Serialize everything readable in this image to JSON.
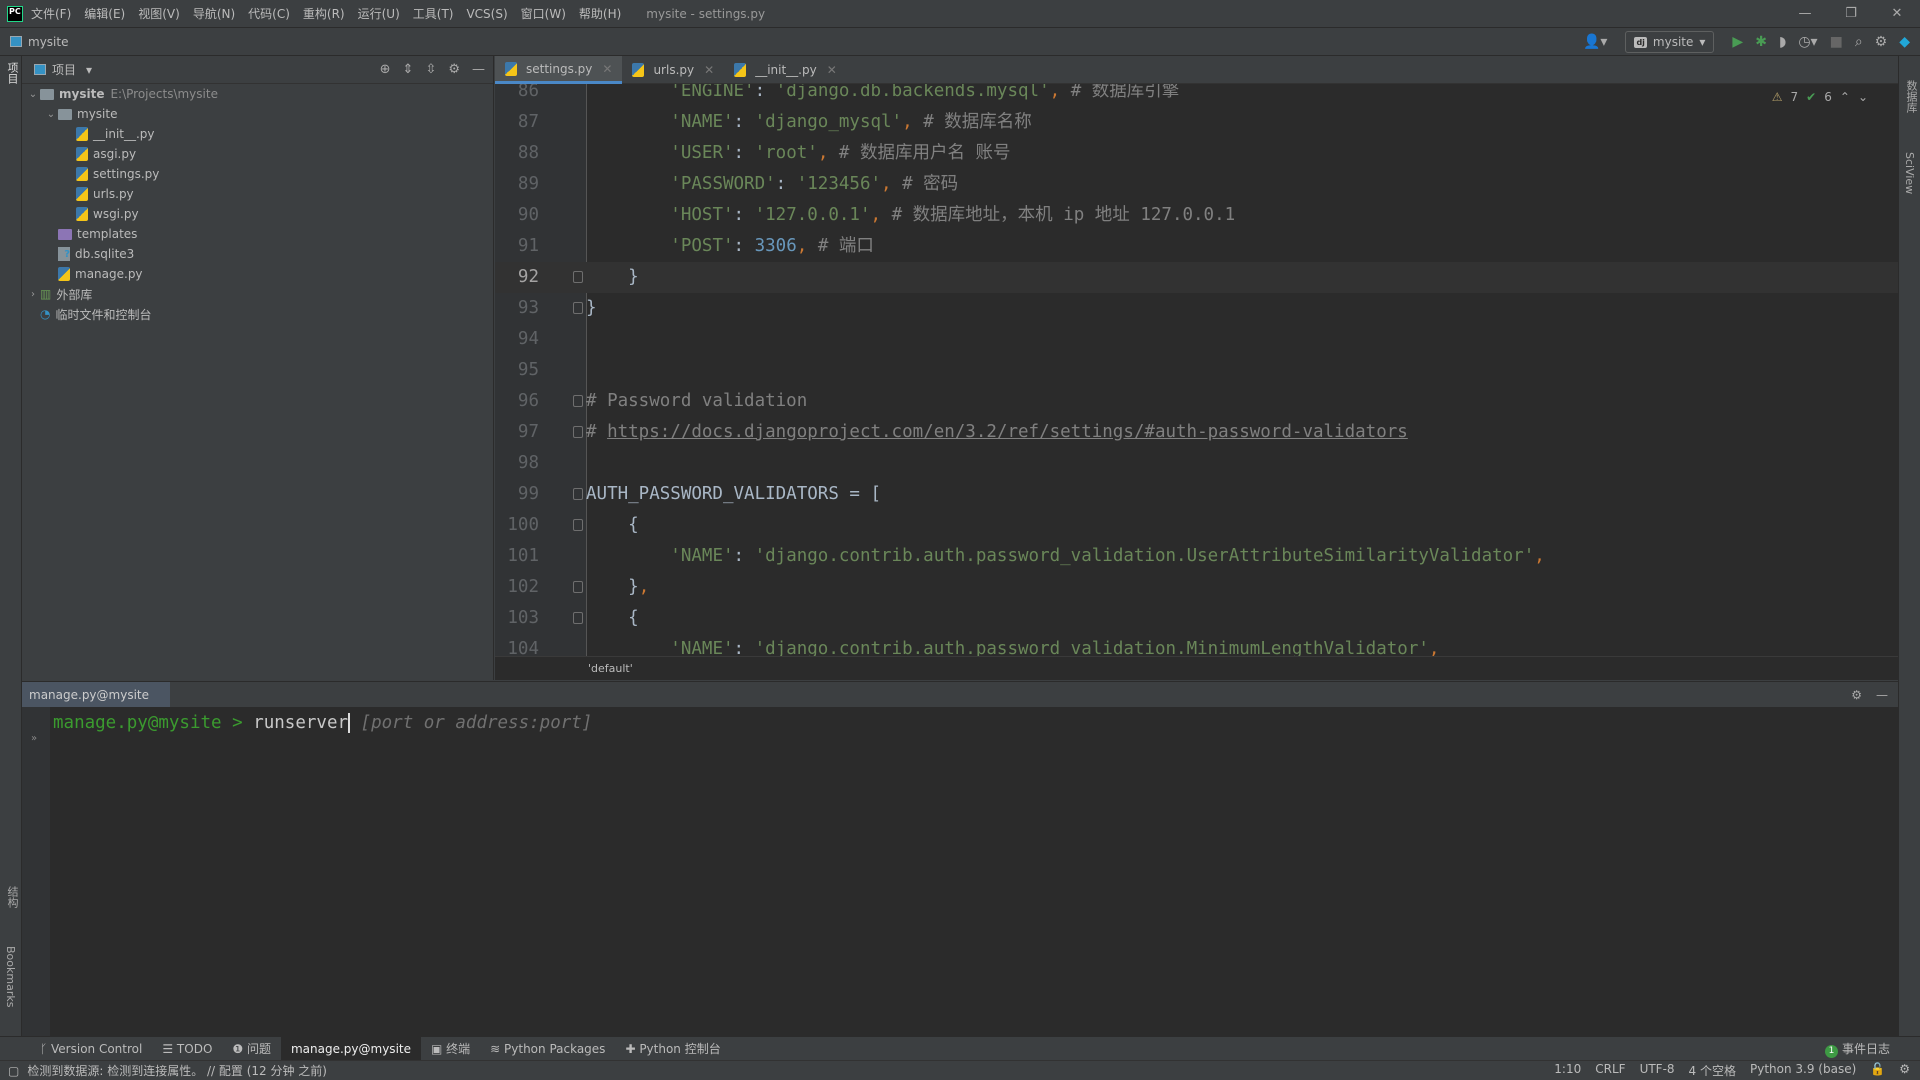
{
  "app": {
    "logo": "PC",
    "window_title": "mysite - settings.py",
    "menu": [
      "文件(F)",
      "编辑(E)",
      "视图(V)",
      "导航(N)",
      "代码(C)",
      "重构(R)",
      "运行(U)",
      "工具(T)",
      "VCS(S)",
      "窗口(W)",
      "帮助(H)"
    ],
    "window_controls": [
      "minimize",
      "restore",
      "close"
    ]
  },
  "nav": {
    "project": "mysite",
    "run_config": "mysite",
    "run_config_badge": "dj"
  },
  "left_strip": {
    "top_label": "项目",
    "bottom_labels": [
      "结构",
      "Bookmarks"
    ]
  },
  "right_strip": {
    "labels": [
      "数据库",
      "SciView"
    ]
  },
  "project_panel": {
    "title": "项目",
    "tree": [
      {
        "label": "mysite",
        "path": "E:\\Projects\\mysite",
        "type": "root",
        "level": 0,
        "expanded": true
      },
      {
        "label": "mysite",
        "type": "package",
        "level": 1,
        "expanded": true
      },
      {
        "label": "__init__.py",
        "type": "py",
        "level": 2
      },
      {
        "label": "asgi.py",
        "type": "py",
        "level": 2
      },
      {
        "label": "settings.py",
        "type": "py",
        "level": 2
      },
      {
        "label": "urls.py",
        "type": "py",
        "level": 2
      },
      {
        "label": "wsgi.py",
        "type": "py",
        "level": 2
      },
      {
        "label": "templates",
        "type": "templates",
        "level": 1
      },
      {
        "label": "db.sqlite3",
        "type": "unknown",
        "level": 1
      },
      {
        "label": "manage.py",
        "type": "py",
        "level": 1
      },
      {
        "label": "外部库",
        "type": "lib",
        "level": 0,
        "expanded": false
      },
      {
        "label": "临时文件和控制台",
        "type": "scratch",
        "level": 0
      }
    ]
  },
  "editor": {
    "tabs": [
      {
        "label": "settings.py",
        "active": true
      },
      {
        "label": "urls.py"
      },
      {
        "label": "__init__.py"
      }
    ],
    "inspections": {
      "warnings": "7",
      "weak_warnings": "6"
    },
    "current_line": 92,
    "lines": [
      {
        "n": "86",
        "t": [
          [
            "        ",
            ""
          ],
          [
            "'ENGINE'",
            "str"
          ],
          [
            ": ",
            ""
          ],
          [
            "'django.db.backends.mysql'",
            "str"
          ],
          [
            ",",
            "pun"
          ],
          [
            " # 数据库引擎",
            "com"
          ]
        ]
      },
      {
        "n": "87",
        "t": [
          [
            "        ",
            ""
          ],
          [
            "'NAME'",
            "str"
          ],
          [
            ": ",
            ""
          ],
          [
            "'django_mysql'",
            "str"
          ],
          [
            ",",
            "pun"
          ],
          [
            " # 数据库名称",
            "com"
          ]
        ]
      },
      {
        "n": "88",
        "t": [
          [
            "        ",
            ""
          ],
          [
            "'USER'",
            "str"
          ],
          [
            ": ",
            ""
          ],
          [
            "'root'",
            "str"
          ],
          [
            ",",
            "pun"
          ],
          [
            " # 数据库用户名 账号",
            "com"
          ]
        ]
      },
      {
        "n": "89",
        "t": [
          [
            "        ",
            ""
          ],
          [
            "'PASSWORD'",
            "str"
          ],
          [
            ": ",
            ""
          ],
          [
            "'123456'",
            "str"
          ],
          [
            ",",
            "pun"
          ],
          [
            " # 密码",
            "com"
          ]
        ]
      },
      {
        "n": "90",
        "t": [
          [
            "        ",
            ""
          ],
          [
            "'HOST'",
            "str"
          ],
          [
            ": ",
            ""
          ],
          [
            "'127.0.0.1'",
            "str"
          ],
          [
            ",",
            "pun"
          ],
          [
            " # 数据库地址，本机 ip 地址 127.0.0.1",
            "com"
          ]
        ]
      },
      {
        "n": "91",
        "t": [
          [
            "        ",
            ""
          ],
          [
            "'POST'",
            "str"
          ],
          [
            ": ",
            ""
          ],
          [
            "3306",
            "num"
          ],
          [
            ",",
            "pun"
          ],
          [
            " # 端口",
            "com"
          ]
        ]
      },
      {
        "n": "92",
        "t": [
          [
            "    }",
            ""
          ]
        ],
        "fold": true
      },
      {
        "n": "93",
        "t": [
          [
            "}",
            ""
          ]
        ],
        "fold": true
      },
      {
        "n": "94",
        "t": []
      },
      {
        "n": "95",
        "t": []
      },
      {
        "n": "96",
        "t": [
          [
            "# Password validation",
            "com"
          ]
        ],
        "fold": true
      },
      {
        "n": "97",
        "t": [
          [
            "# ",
            "com"
          ],
          [
            "https://docs.djangoproject.com/en/3.2/ref/settings/#auth-password-validators",
            "url"
          ]
        ],
        "fold": true
      },
      {
        "n": "98",
        "t": []
      },
      {
        "n": "99",
        "t": [
          [
            "AUTH_PASSWORD_VALIDATORS = [",
            ""
          ]
        ],
        "fold": true
      },
      {
        "n": "100",
        "t": [
          [
            "    {",
            ""
          ]
        ],
        "fold": true
      },
      {
        "n": "101",
        "t": [
          [
            "        ",
            ""
          ],
          [
            "'NAME'",
            "str"
          ],
          [
            ": ",
            ""
          ],
          [
            "'django.contrib.auth.password_validation.UserAttributeSimilarityValidator'",
            "str"
          ],
          [
            ",",
            "pun"
          ]
        ]
      },
      {
        "n": "102",
        "t": [
          [
            "    }",
            ""
          ],
          [
            ",",
            "pun"
          ]
        ],
        "fold": true
      },
      {
        "n": "103",
        "t": [
          [
            "    {",
            ""
          ]
        ],
        "fold": true
      },
      {
        "n": "104",
        "t": [
          [
            "        ",
            ""
          ],
          [
            "'NAME'",
            "str"
          ],
          [
            ": ",
            ""
          ],
          [
            "'django.contrib.auth.password_validation.MinimumLengthValidator'",
            "str"
          ],
          [
            ",",
            "pun"
          ]
        ]
      }
    ],
    "breadcrumb": "'default'"
  },
  "run_panel": {
    "tab": "manage.py@mysite",
    "prompt": "manage.py@mysite > ",
    "command": "runserver",
    "hint": " [port or address:port]"
  },
  "tool_windows": [
    {
      "label": "Version Control",
      "icon": "branch-icon"
    },
    {
      "label": "TODO",
      "icon": "list-icon"
    },
    {
      "label": "问题",
      "icon": "info-icon"
    },
    {
      "label": "manage.py@mysite",
      "active": true
    },
    {
      "label": "终端",
      "icon": "terminal-icon"
    },
    {
      "label": "Python Packages",
      "icon": "layers-icon"
    },
    {
      "label": "Python 控制台",
      "icon": "python-icon"
    }
  ],
  "event_log": {
    "count": "1",
    "label": "事件日志"
  },
  "status": {
    "message": "检测到数据源: 检测到连接属性。 // 配置 (12 分钟 之前)",
    "position": "1:10",
    "line_sep": "CRLF",
    "encoding": "UTF-8",
    "indent": "4 个空格",
    "interpreter": "Python 3.9 (base)"
  },
  "colors": {
    "editor_bg": "#2b2b2b",
    "panel_bg": "#3c3f41",
    "string": "#6a8759",
    "comment": "#808080",
    "number": "#6897bb",
    "accent": "#4a88c7",
    "prompt_green": "#3b9b2f"
  }
}
